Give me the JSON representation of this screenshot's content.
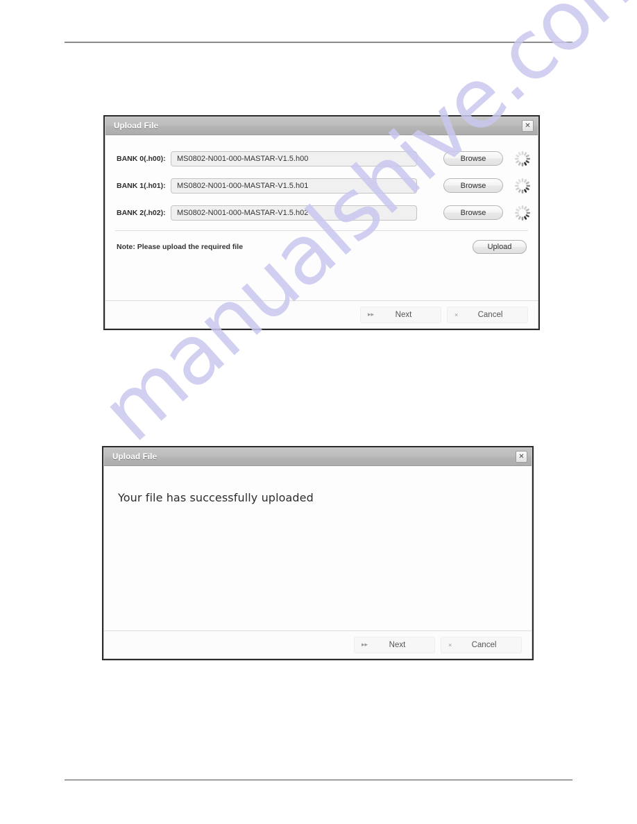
{
  "page": {
    "header_rule": true,
    "footer_rule": true,
    "watermark": "manualshive.com"
  },
  "dialog_upload": {
    "title": "Upload File",
    "close_icon": "close-icon",
    "close_glyph": "✕",
    "rows": [
      {
        "label": "BANK 0(.h00):",
        "value": "MS0802-N001-000-MASTAR-V1.5.h00",
        "placeholder": "",
        "browse_label": "Browse",
        "spinner_icon": "loading-spinner-icon"
      },
      {
        "label": "BANK 1(.h01):",
        "value": "MS0802-N001-000-MASTAR-V1.5.h01",
        "placeholder": "",
        "browse_label": "Browse",
        "spinner_icon": "loading-spinner-icon"
      },
      {
        "label": "BANK 2(.h02):",
        "value": "MS0802-N001-000-MASTAR-V1.5.h02",
        "placeholder": "",
        "browse_label": "Browse",
        "spinner_icon": "loading-spinner-icon"
      }
    ],
    "note": "Note: Please upload the required file",
    "upload_label": "Upload",
    "footer": {
      "next_label": "Next",
      "next_icon_glyph": "▸▸",
      "cancel_label": "Cancel",
      "cancel_icon_glyph": "×"
    }
  },
  "dialog_success": {
    "title": "Upload File",
    "close_icon": "close-icon",
    "close_glyph": "✕",
    "message": "Your file has successfully uploaded",
    "footer": {
      "next_label": "Next",
      "next_icon_glyph": "▸▸",
      "cancel_label": "Cancel",
      "cancel_icon_glyph": "×"
    }
  },
  "colors": {
    "titlebar": "#b8b8b8",
    "dialog_border": "#2b2b2b",
    "input_bg": "#f0f0f0",
    "watermark": "#c9c8ef",
    "rule": "#8b8b8b"
  }
}
